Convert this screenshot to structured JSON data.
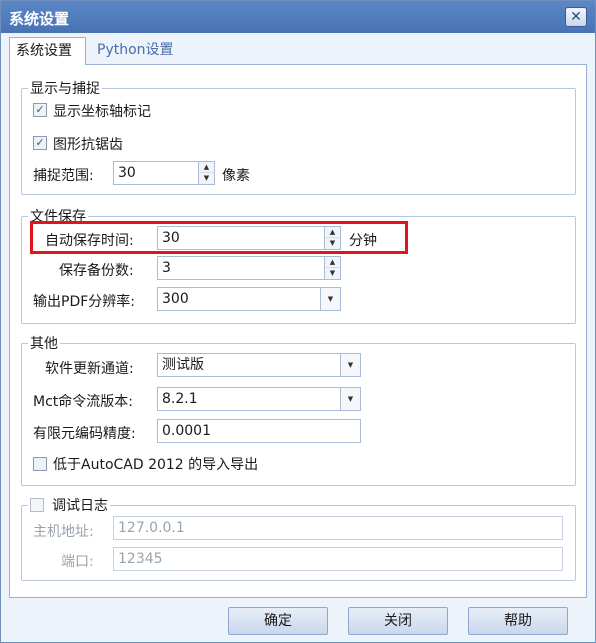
{
  "window": {
    "title": "系统设置",
    "close_glyph": "✕"
  },
  "tabs": [
    {
      "label": "系统设置"
    },
    {
      "label": "Python设置"
    }
  ],
  "display": {
    "legend": "显示与捕捉",
    "show_axis_label": "显示坐标轴标记",
    "show_axis_checked": true,
    "antialias_label": "图形抗锯齿",
    "antialias_checked": true,
    "snap_label": "捕捉范围:",
    "snap_value": "30",
    "snap_unit": "像素"
  },
  "file_save": {
    "legend": "文件保存",
    "autosave_label": "自动保存时间:",
    "autosave_value": "30",
    "autosave_unit": "分钟",
    "backup_label": "保存备份数:",
    "backup_value": "3",
    "pdf_label": "输出PDF分辨率:",
    "pdf_value": "300"
  },
  "other": {
    "legend": "其他",
    "update_label": "软件更新通道:",
    "update_value": "测试版",
    "mct_label": "Mct命令流版本:",
    "mct_value": "8.2.1",
    "fem_label": "有限元编码精度:",
    "fem_value": "0.0001",
    "autocad_label": "低于AutoCAD 2012 的导入导出",
    "autocad_checked": false
  },
  "debug": {
    "legend": "调试日志",
    "enabled": false,
    "host_label": "主机地址:",
    "host_value": "127.0.0.1",
    "port_label": "端口:",
    "port_value": "12345"
  },
  "buttons": {
    "ok": "确定",
    "close": "关闭",
    "help": "帮助"
  },
  "icons": {
    "check": "✓",
    "spin_up": "▲",
    "spin_down": "▼",
    "dropdown": "▼"
  },
  "colors": {
    "highlight": "#e0141b",
    "title_bar": "#4873b5"
  }
}
